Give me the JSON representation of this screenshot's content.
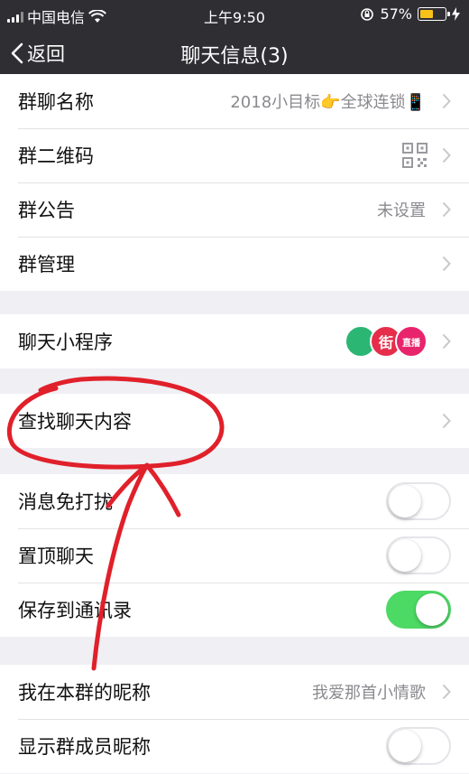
{
  "status_bar": {
    "carrier": "中国电信",
    "time": "上午9:50",
    "battery": "57%",
    "battery_level": 0.57
  },
  "nav": {
    "back_label": "返回",
    "title": "聊天信息(3)"
  },
  "group_info": [
    {
      "label": "群聊名称",
      "value": "2018小目标👉全球连锁📱"
    },
    {
      "label": "群二维码",
      "icon": "qr-code-icon"
    },
    {
      "label": "群公告",
      "value": "未设置"
    },
    {
      "label": "群管理"
    }
  ],
  "mini_programs": {
    "label": "聊天小程序",
    "icons": [
      {
        "name": "mini-program-green-icon",
        "color": "#2bb673",
        "text": ""
      },
      {
        "name": "mini-program-jie-icon",
        "color": "#e62e4b",
        "text": "街"
      },
      {
        "name": "mini-program-live-icon",
        "color": "#e8246c",
        "text": "直播"
      }
    ]
  },
  "search": {
    "label": "查找聊天内容"
  },
  "toggles": [
    {
      "label": "消息免打扰",
      "on": false
    },
    {
      "label": "置顶聊天",
      "on": false
    },
    {
      "label": "保存到通讯录",
      "on": true
    }
  ],
  "nickname": {
    "my_nickname_label": "我在本群的昵称",
    "my_nickname_value": "我爱那首小情歌",
    "show_nickname_label": "显示群成员昵称",
    "show_nickname_on": false
  },
  "colors": {
    "nav_bg": "#2e2e33",
    "toggle_on": "#4cd964",
    "annotation": "#e0202a",
    "battery": "#f7c31a"
  }
}
